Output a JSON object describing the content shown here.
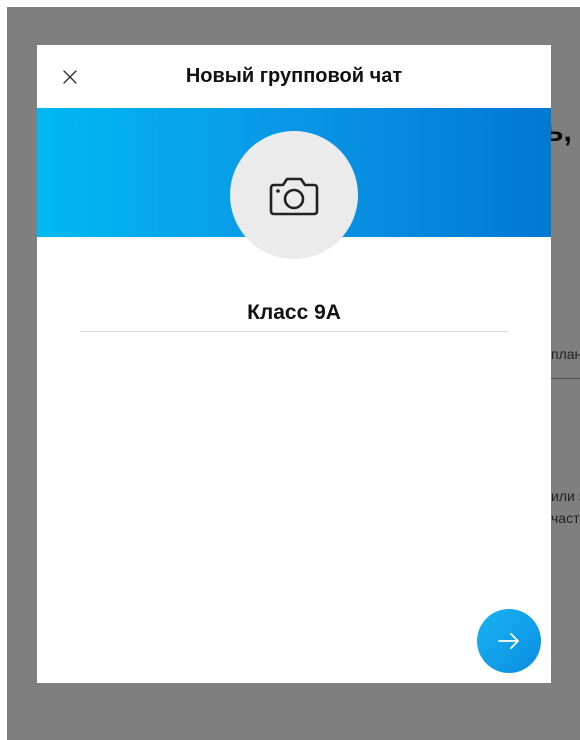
{
  "background": {
    "title_fragment": "ь,",
    "text_fragments": [
      "план",
      "или з",
      "част"
    ]
  },
  "dialog": {
    "title": "Новый групповой чат",
    "close_icon": "close-icon",
    "avatar_icon": "camera-icon",
    "group_name_value": "Класс 9А",
    "next_icon": "arrow-right-icon",
    "banner_colors": [
      "#00b9f1",
      "#0078d4"
    ],
    "accent_color": "#0a8de0"
  }
}
